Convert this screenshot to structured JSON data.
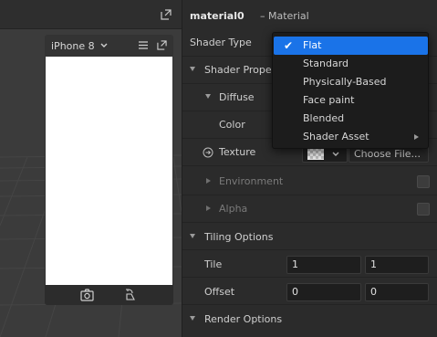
{
  "viewport": {
    "device_name": "iPhone 8"
  },
  "inspector": {
    "material_name": "material0",
    "material_type": "– Material",
    "shader_type_label": "Shader Type",
    "shader_properties_label": "Shader Properti",
    "diffuse_label": "Diffuse",
    "color_label": "Color",
    "texture_label": "Texture",
    "choose_file_label": "Choose File...",
    "environment_label": "Environment",
    "alpha_label": "Alpha",
    "tiling_options_label": "Tiling Options",
    "tile_label": "Tile",
    "tile_x": "1",
    "tile_y": "1",
    "offset_label": "Offset",
    "offset_x": "0",
    "offset_y": "0",
    "render_options_label": "Render Options"
  },
  "shader_menu": {
    "items": [
      {
        "label": "Flat",
        "selected": true
      },
      {
        "label": "Standard",
        "selected": false
      },
      {
        "label": "Physically-Based",
        "selected": false
      },
      {
        "label": "Face paint",
        "selected": false
      },
      {
        "label": "Blended",
        "selected": false
      },
      {
        "label": "Shader Asset",
        "selected": false,
        "submenu": true
      }
    ]
  },
  "colors": {
    "accent": "#1a73e8",
    "panel": "#2b2b2b",
    "viewport": "#3a3a3a"
  }
}
